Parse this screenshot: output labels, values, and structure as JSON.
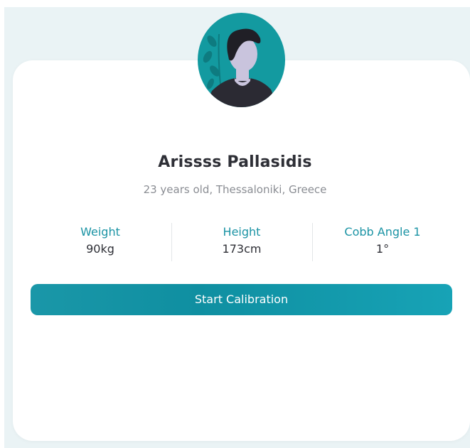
{
  "profile": {
    "name": "Arissss Pallasidis",
    "subtitle": "23 years old, Thessaloniki, Greece",
    "avatar_icon": "user-avatar-illustration"
  },
  "stats": [
    {
      "label": "Weight",
      "value": "90kg"
    },
    {
      "label": "Height",
      "value": "173cm"
    },
    {
      "label": "Cobb Angle 1",
      "value": "1°"
    }
  ],
  "actions": {
    "start_calibration_label": "Start Calibration"
  },
  "colors": {
    "accent": "#1a93a4",
    "avatar_bg": "#139aa0",
    "page_bg": "#eaf3f5",
    "card_bg": "#ffffff",
    "text_dark": "#2e2f36",
    "text_muted": "#8a8d93"
  }
}
